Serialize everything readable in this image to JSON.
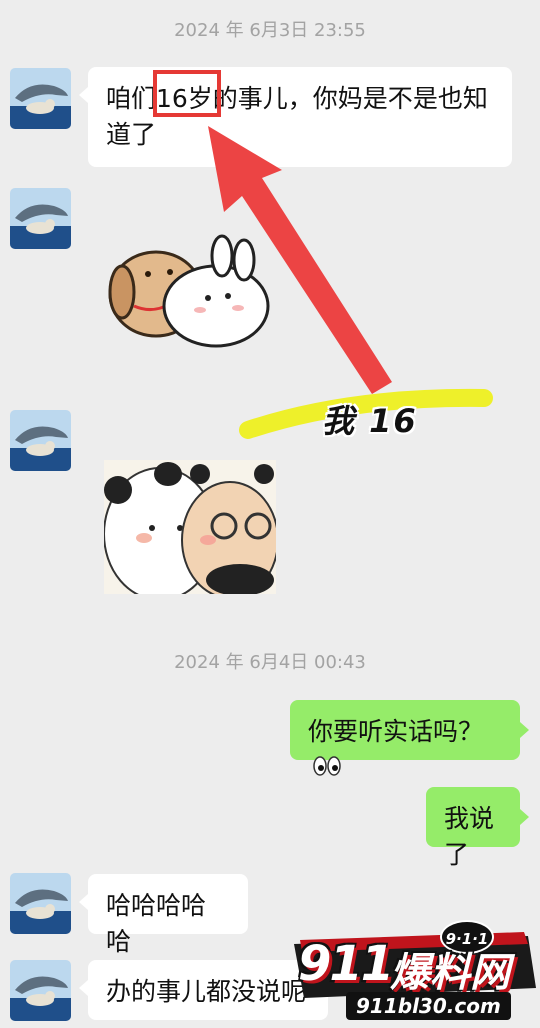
{
  "timestamps": [
    "2024 年 6月3日  23:55",
    "2024 年 6月4日  00:43"
  ],
  "messages": [
    {
      "side": "left",
      "type": "text",
      "text": "咱们16岁的事儿，你妈是不是也知道了"
    },
    {
      "side": "left",
      "type": "sticker",
      "sticker": "dog-and-bunny-hug"
    },
    {
      "side": "left",
      "type": "sticker",
      "sticker": "panda-and-bear-cuddle"
    },
    {
      "side": "right",
      "type": "text",
      "text": "你要听实话吗？",
      "emoji": "eyes-icon"
    },
    {
      "side": "right",
      "type": "text",
      "text": "我说了"
    },
    {
      "side": "left",
      "type": "text",
      "text": "哈哈哈哈哈"
    },
    {
      "side": "left",
      "type": "text",
      "text": "办的事儿都没说呢"
    }
  ],
  "annotation": {
    "text": "我 16",
    "highlight_color": "#e53935",
    "marker_color": "#f0f01a"
  },
  "watermark": {
    "number": "911",
    "name": "爆料网",
    "badge": "9·1·1",
    "url": "911bl30.com"
  },
  "colors": {
    "background": "#ededed",
    "left_bubble": "#ffffff",
    "right_bubble": "#95ec69"
  }
}
